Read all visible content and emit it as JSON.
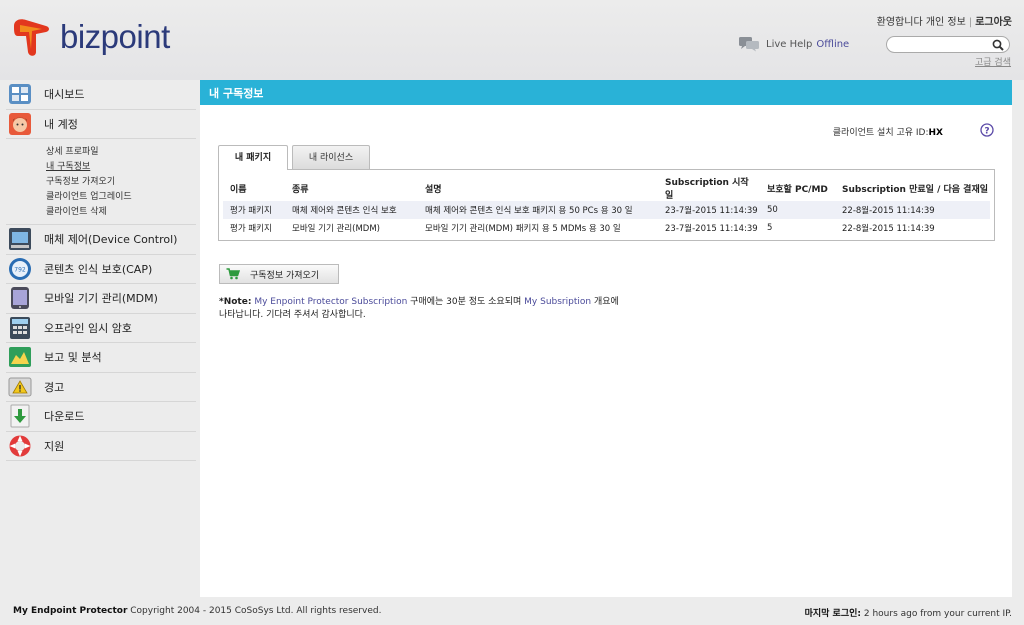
{
  "brand": {
    "name": "bizpoint"
  },
  "top_bar": {
    "welcome": "환영합니다",
    "profile": "개인 정보",
    "logout": "로그아웃"
  },
  "live_help": {
    "label": "Live Help",
    "status": "Offline"
  },
  "search": {
    "placeholder": "",
    "advanced": "고급 검색"
  },
  "sidebar": {
    "items": [
      {
        "label": "대시보드",
        "icon": "dashboard-icon"
      },
      {
        "label": "내 계정",
        "icon": "account-avatar-icon"
      },
      {
        "label": "매체 제어(Device Control)",
        "icon": "device-control-icon"
      },
      {
        "label": "콘텐츠 인식 보호(CAP)",
        "icon": "content-protection-icon"
      },
      {
        "label": "모바일 기기 관리(MDM)",
        "icon": "mobile-device-icon"
      },
      {
        "label": "오프라인 임시 암호",
        "icon": "offline-password-icon"
      },
      {
        "label": "보고 및 분석",
        "icon": "report-chart-icon"
      },
      {
        "label": "경고",
        "icon": "warning-icon"
      },
      {
        "label": "다운로드",
        "icon": "download-icon"
      },
      {
        "label": "지원",
        "icon": "support-lifebuoy-icon"
      }
    ],
    "sub_items": [
      {
        "label": "상세 프로파일"
      },
      {
        "label": "내 구독정보"
      },
      {
        "label": "구독정보 가져오기"
      },
      {
        "label": "클라이언트 업그레이드"
      },
      {
        "label": "클라이언트 삭제"
      }
    ]
  },
  "content": {
    "title": "내 구독정보",
    "client_id_label": "클라이언트 설치 고유 ID:",
    "client_id_value": "HX",
    "tabs": [
      {
        "label": "내 패키지"
      },
      {
        "label": "내 라이선스"
      }
    ],
    "table": {
      "headers": [
        "이름",
        "종류",
        "설명",
        "Subscription 시작 일",
        "보호할 PC/MD",
        "Subscription 만료일 / 다음 결재일"
      ],
      "rows": [
        [
          "평가 패키지",
          "매체 제어와 콘텐츠 인식 보호",
          "매체 제어와 콘텐츠 인식 보호 패키지 용 50 PCs 용 30 일",
          "23-7월-2015 11:14:39",
          "50",
          "22-8월-2015 11:14:39"
        ],
        [
          "평가 패키지",
          "모바일 기기 관리(MDM)",
          "모바일 기기 관리(MDM) 패키지 용 5 MDMs 용 30 일",
          "23-7월-2015 11:14:39",
          "5",
          "22-8월-2015 11:14:39"
        ]
      ]
    },
    "fetch_button": "구독정보 가져오기",
    "note": {
      "label": "*Note:",
      "part1": "My Enpoint Protector Subscription",
      "part2": "구매에는 30분 정도 소요되며",
      "part3": "My Subsription",
      "part4": "개요에",
      "part5": "나타납니다. 기다려 주셔서 감사합니다."
    }
  },
  "footer": {
    "product": "My Endpoint Protector",
    "copyright": "Copyright 2004 - 2015 CoSoSys Ltd. All rights reserved.",
    "last_login_label": "마지막 로그인:",
    "last_login_value": "2 hours ago from your current IP."
  },
  "colors": {
    "accent": "#29b2d7",
    "brand_text": "#2b3a7a",
    "link": "#4b4b9a"
  }
}
